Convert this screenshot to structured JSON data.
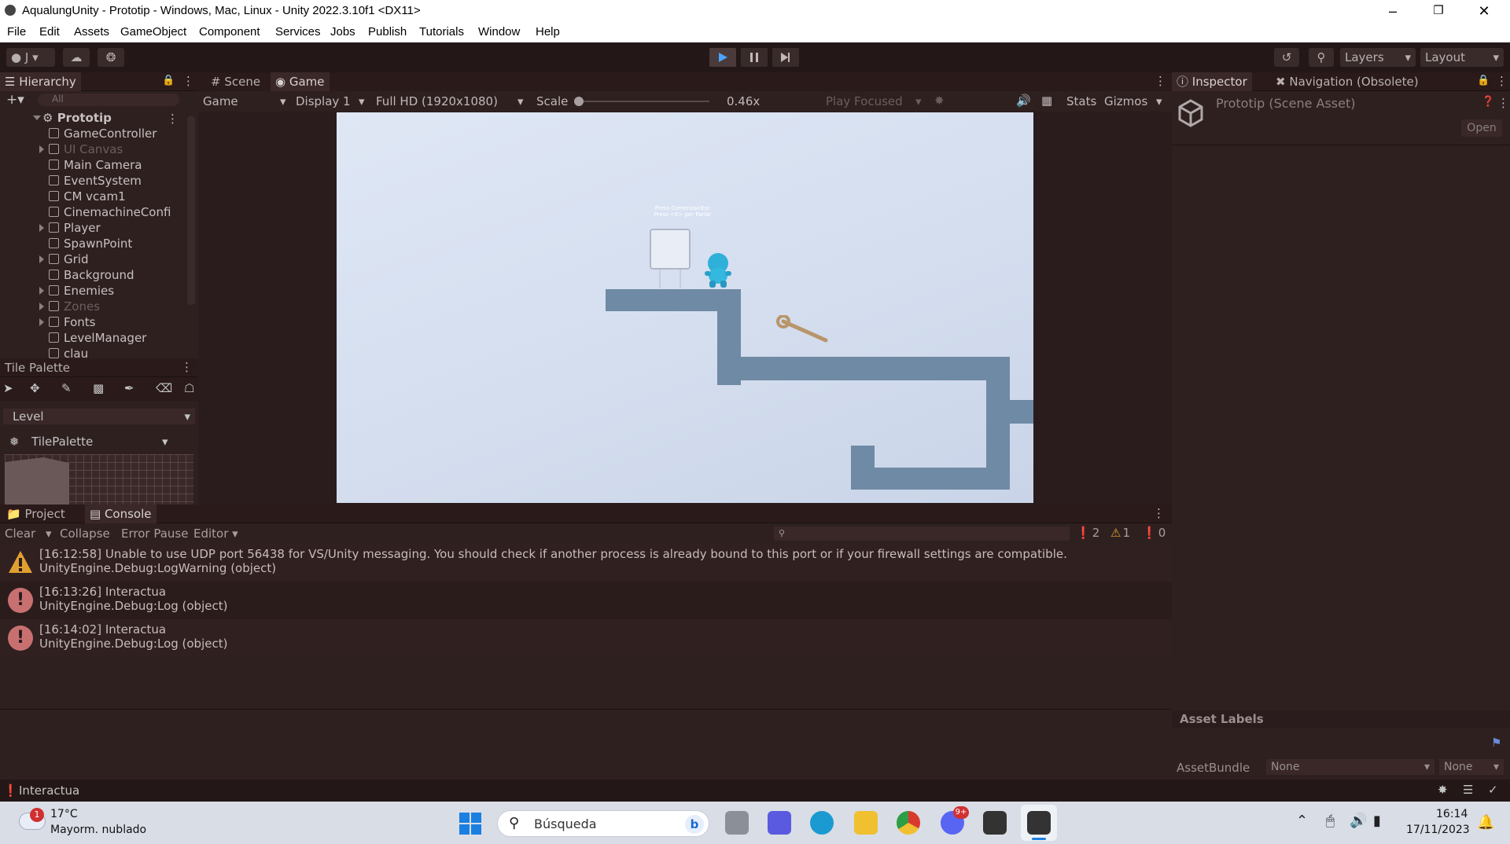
{
  "window": {
    "title": "AqualungUnity - Prototip - Windows, Mac, Linux - Unity 2022.3.10f1 <DX11>"
  },
  "menu": [
    "File",
    "Edit",
    "Assets",
    "GameObject",
    "Component",
    "Services",
    "Jobs",
    "Publish",
    "Tutorials",
    "Window",
    "Help"
  ],
  "toolbar": {
    "account": "J",
    "layers": "Layers",
    "layout": "Layout"
  },
  "hierarchy": {
    "tab": "Hierarchy",
    "search_placeholder": "All",
    "scene": "Prototip",
    "items": [
      {
        "label": "GameController",
        "arrow": false,
        "dim": false
      },
      {
        "label": "UI Canvas",
        "arrow": true,
        "dim": true
      },
      {
        "label": "Main Camera",
        "arrow": false,
        "dim": false
      },
      {
        "label": "EventSystem",
        "arrow": false,
        "dim": false
      },
      {
        "label": "CM vcam1",
        "arrow": false,
        "dim": false
      },
      {
        "label": "CinemachineConfi",
        "arrow": false,
        "dim": false
      },
      {
        "label": "Player",
        "arrow": true,
        "dim": false
      },
      {
        "label": "SpawnPoint",
        "arrow": false,
        "dim": false
      },
      {
        "label": "Grid",
        "arrow": true,
        "dim": false
      },
      {
        "label": "Background",
        "arrow": false,
        "dim": false
      },
      {
        "label": "Enemies",
        "arrow": true,
        "dim": false
      },
      {
        "label": "Zones",
        "arrow": true,
        "dim": true
      },
      {
        "label": "Fonts",
        "arrow": true,
        "dim": false
      },
      {
        "label": "LevelManager",
        "arrow": false,
        "dim": false
      },
      {
        "label": "clau",
        "arrow": false,
        "dim": false
      }
    ]
  },
  "tile_palette": {
    "tab": "Tile Palette",
    "layer": "Level",
    "palette": "TilePalette"
  },
  "game_tabs": {
    "scene": "Scene",
    "game": "Game"
  },
  "game_bar": {
    "mode": "Game",
    "display": "Display 1",
    "resolution": "Full HD (1920x1080)",
    "scale_label": "Scale",
    "scale_value": "0.46x",
    "play_focused": "Play Focused",
    "stats": "Stats",
    "gizmos": "Gizmos"
  },
  "game_scene": {
    "sign_line1": "Press Comenzar/Esc",
    "sign_line2": "Press <E> per Parlar"
  },
  "inspector": {
    "tab": "Inspector",
    "nav_tab": "Navigation (Obsolete)",
    "asset_title": "Prototip (Scene Asset)",
    "open_label": "Open",
    "asset_labels": "Asset Labels",
    "assetbundle_label": "AssetBundle",
    "assetbundle_value": "None",
    "variant_value": "None"
  },
  "console": {
    "project_tab": "Project",
    "console_tab": "Console",
    "clear": "Clear",
    "collapse": "Collapse",
    "error_pause": "Error Pause",
    "editor": "Editor",
    "count_log": "2",
    "count_warn": "1",
    "count_err": "0",
    "logs": [
      {
        "type": "warning",
        "line1": "[16:12:58] Unable to use UDP port 56438 for VS/Unity messaging. You should check if another process is already bound to this port or if your firewall settings are compatible.",
        "line2": "UnityEngine.Debug:LogWarning (object)"
      },
      {
        "type": "log",
        "line1": "[16:13:26] Interactua",
        "line2": "UnityEngine.Debug:Log (object)"
      },
      {
        "type": "log",
        "line1": "[16:14:02] Interactua",
        "line2": "UnityEngine.Debug:Log (object)"
      }
    ]
  },
  "status": {
    "text": "Interactua"
  },
  "taskbar": {
    "weather_temp": "17°C",
    "weather_desc": "Mayorm. nublado",
    "weather_badge": "1",
    "search": "Búsqueda",
    "time": "16:14",
    "date": "17/11/2023",
    "discord_badge": "9+"
  },
  "colors": {
    "unity_bg": "#2f2020",
    "game_sky": "#d8e1f1",
    "tile": "#6f8aa4",
    "warning": "#e0a030",
    "log": "#c87070"
  }
}
